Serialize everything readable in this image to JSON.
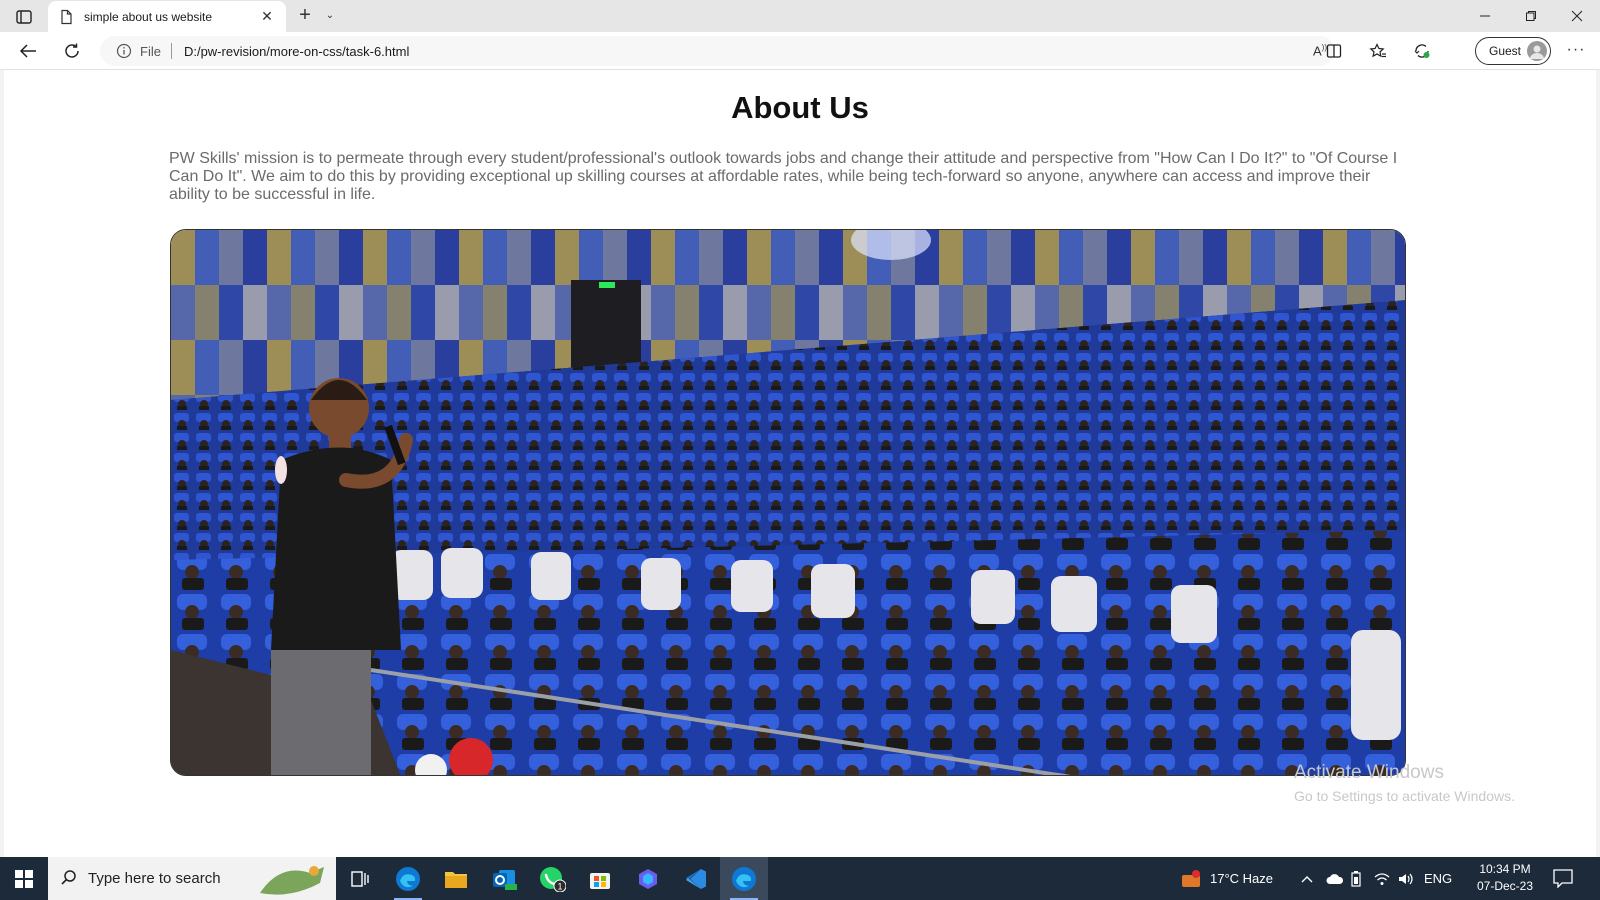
{
  "browser": {
    "tab_title": "simple about us website",
    "scheme_label": "File",
    "url": "D:/pw-revision/more-on-css/task-6.html",
    "profile_label": "Guest"
  },
  "page": {
    "heading": "About Us",
    "paragraph": "PW Skills' mission is to permeate through every student/professional's outlook towards jobs and change their attitude and perspective from \"How Can I Do It?\" to \"Of Course I Can Do It\". We aim to do this by providing exceptional up skilling courses at affordable rates, while being tech-forward so anyone, anywhere can access and improve their ability to be successful in life.",
    "image_icon": "auditorium-photo"
  },
  "watermark": {
    "line1": "Activate Windows",
    "line2": "Go to Settings to activate Windows."
  },
  "taskbar": {
    "search_placeholder": "Type here to search",
    "weather": "17°C  Haze",
    "language": "ENG",
    "time": "10:34 PM",
    "date": "07-Dec-23",
    "apps": [
      "task-view-icon",
      "edge-icon",
      "file-explorer-icon",
      "outlook-icon",
      "whatsapp-icon",
      "store-icon",
      "copilot-icon",
      "vscode-icon",
      "edge-dev-icon"
    ],
    "whatsapp_badge": "1"
  },
  "colors": {
    "taskbar": "#1c2a3a",
    "heading": "#111111",
    "paragraph": "#6b6b6b",
    "edge_blue": "#0f78d4",
    "vscode_blue": "#2b8ae3"
  }
}
